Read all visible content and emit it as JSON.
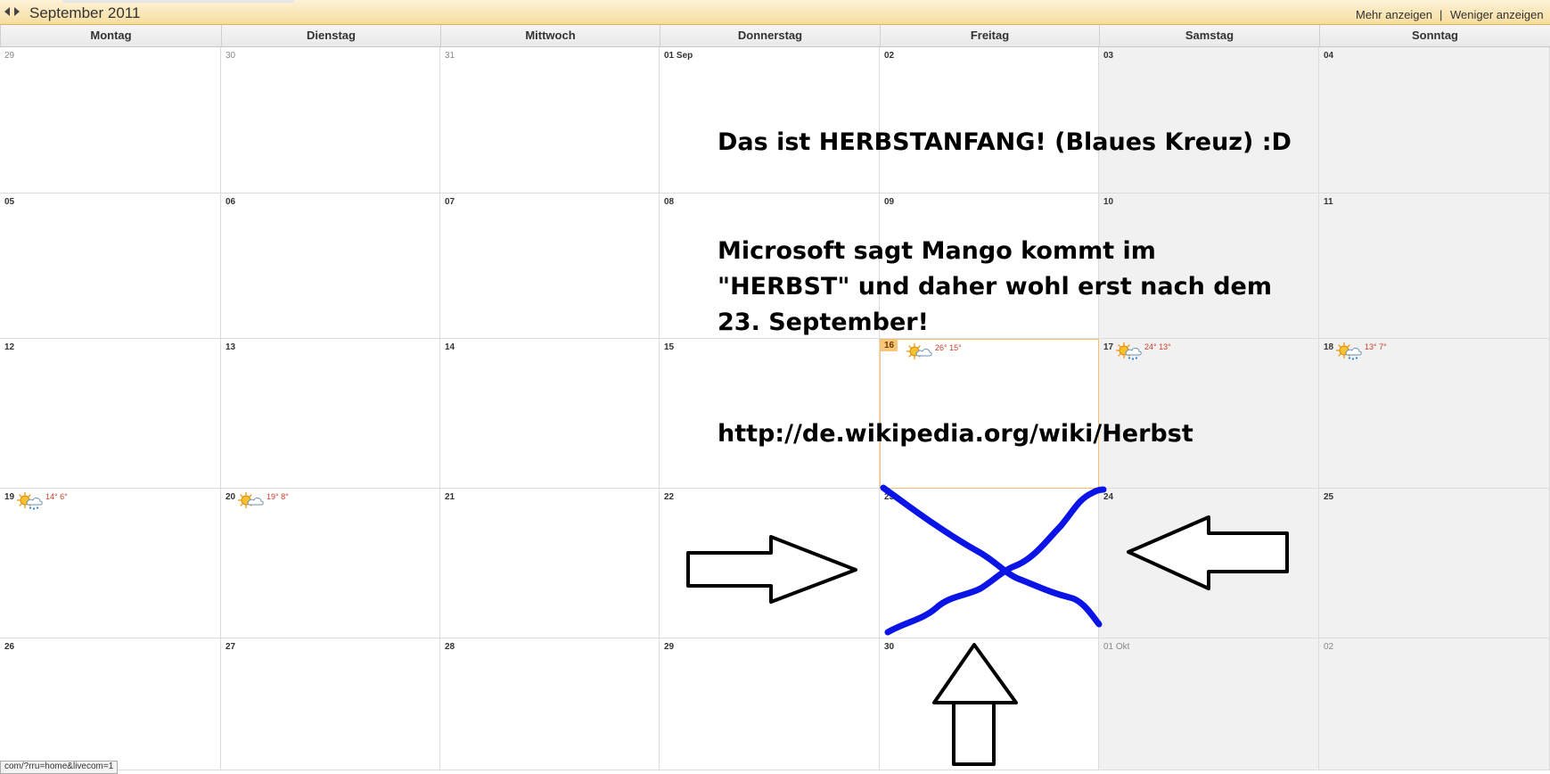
{
  "toolbar": {
    "month_title": "September 2011",
    "more_label": "Mehr anzeigen",
    "separator": "|",
    "less_label": "Weniger anzeigen"
  },
  "weekdays": [
    "Montag",
    "Dienstag",
    "Mittwoch",
    "Donnerstag",
    "Freitag",
    "Samstag",
    "Sonntag"
  ],
  "weeks": [
    [
      {
        "label": "29",
        "other": true
      },
      {
        "label": "30",
        "other": true
      },
      {
        "label": "31",
        "other": true
      },
      {
        "label": "01 Sep"
      },
      {
        "label": "02"
      },
      {
        "label": "03"
      },
      {
        "label": "04"
      }
    ],
    [
      {
        "label": "05"
      },
      {
        "label": "06"
      },
      {
        "label": "07"
      },
      {
        "label": "08"
      },
      {
        "label": "09"
      },
      {
        "label": "10"
      },
      {
        "label": "11"
      }
    ],
    [
      {
        "label": "12"
      },
      {
        "label": "13"
      },
      {
        "label": "14"
      },
      {
        "label": "15"
      },
      {
        "label": "16",
        "today": true,
        "weather": {
          "icon": "sun-cloud-icon",
          "temp": "26° 15°"
        }
      },
      {
        "label": "17",
        "weather": {
          "icon": "rain-cloud-icon",
          "temp": "24° 13°"
        }
      },
      {
        "label": "18",
        "weather": {
          "icon": "rain-cloud-icon",
          "temp": "13° 7°"
        }
      }
    ],
    [
      {
        "label": "19",
        "weather": {
          "icon": "rain-cloud-icon",
          "temp": "14° 6°"
        }
      },
      {
        "label": "20",
        "weather": {
          "icon": "sun-cloud-icon",
          "temp": "19° 8°"
        }
      },
      {
        "label": "21"
      },
      {
        "label": "22"
      },
      {
        "label": "23"
      },
      {
        "label": "24"
      },
      {
        "label": "25"
      }
    ],
    [
      {
        "label": "26"
      },
      {
        "label": "27"
      },
      {
        "label": "28"
      },
      {
        "label": "29"
      },
      {
        "label": "30"
      },
      {
        "label": "01 Okt",
        "other": true
      },
      {
        "label": "02",
        "other": true
      }
    ]
  ],
  "annotation": {
    "line1": "Das ist HERBSTANFANG! (Blaues Kreuz) :D",
    "line2": "Microsoft sagt Mango kommt im",
    "line3": "\"HERBST\" und daher wohl erst nach dem",
    "line4": "23. September!",
    "line5": "http://de.wikipedia.org/wiki/Herbst"
  },
  "colors": {
    "cross": "#0a14e6",
    "today_highlight": "#f9c577",
    "weekend_bg": "#f1f1f1"
  },
  "status_url": "com/?rru=home&livecom=1"
}
